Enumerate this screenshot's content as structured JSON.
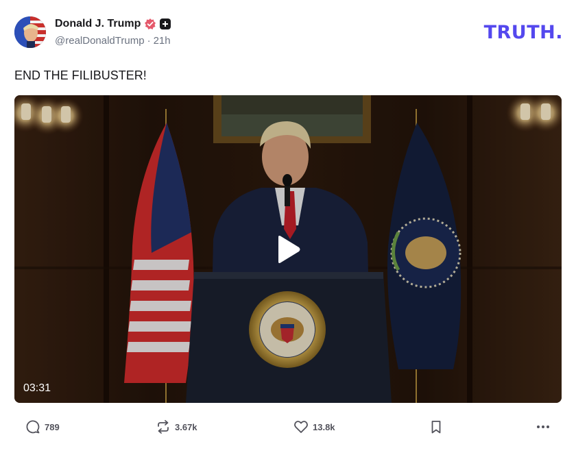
{
  "post": {
    "author": {
      "display_name": "Donald J. Trump",
      "handle": "@realDonaldTrump",
      "time_ago": "21h",
      "meta_separator": "·"
    },
    "brand": {
      "logo_text": "TRUTH",
      "logo_dot": ".",
      "accent_color": "#5448ee"
    },
    "text": "END THE FILIBUSTER!",
    "media": {
      "type": "video",
      "duration": "03:31",
      "play_icon": "play-icon"
    },
    "actions": {
      "replies": "789",
      "retruths": "3.67k",
      "likes": "13.8k"
    }
  }
}
